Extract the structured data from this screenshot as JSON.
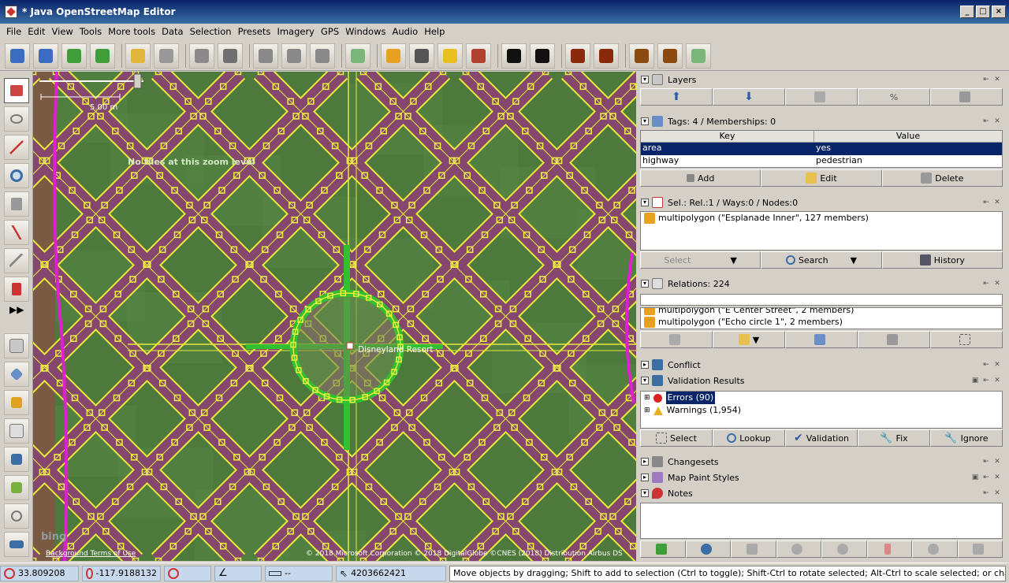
{
  "window": {
    "title": "* Java OpenStreetMap Editor"
  },
  "menu": [
    "File",
    "Edit",
    "View",
    "Tools",
    "More tools",
    "Data",
    "Selection",
    "Presets",
    "Imagery",
    "GPS",
    "Windows",
    "Audio",
    "Help"
  ],
  "toolbar": {
    "icons": [
      "open-icon",
      "save-icon",
      "download-icon",
      "upload-icon",
      "undo-icon",
      "redo-icon",
      "zoom-data-icon",
      "preferences-icon",
      "split-way-icon",
      "combine-way-icon",
      "reverse-way-icon",
      "orthogonalize-icon",
      "highway-preset-icon",
      "road-preset-icon",
      "traffic-signals-icon",
      "barrier-preset-icon",
      "car-icon",
      "bus-icon",
      "shop-icon",
      "restaurant-icon",
      "castle-icon",
      "industrial-icon",
      "waterway-icon"
    ],
    "colors": [
      "#3b6cc2",
      "#3b6cc2",
      "#3f9e3a",
      "#3f9e3a",
      "#e2b63a",
      "#999999",
      "#8a8a8a",
      "#707070",
      "#8a8a8a",
      "#8a8a8a",
      "#8a8a8a",
      "#7ab87a",
      "#e8a020",
      "#555555",
      "#e8c020",
      "#b04030",
      "#111111",
      "#111111",
      "#8a2a0a",
      "#8a2a0a",
      "#8a4a10",
      "#8a4a10",
      "#7ab87a"
    ]
  },
  "map": {
    "scale_label": "5.00 m",
    "no_tiles_label": "No tiles at this zoom level",
    "poi_label": "Disneyland Resort",
    "attribution": "© 2018 Microsoft Corporation © 2018 DigitalGlobe ©CNES (2018) Distribution Airbus DS",
    "bg_terms": "Background Terms of Use",
    "bing_logo": "bing"
  },
  "panels": {
    "layers": {
      "title": "Layers"
    },
    "tags": {
      "title": "Tags: 4 / Memberships: 0",
      "col_key": "Key",
      "col_value": "Value",
      "rows": [
        {
          "key": "area",
          "value": "yes"
        },
        {
          "key": "highway",
          "value": "pedestrian"
        }
      ],
      "add": "Add",
      "edit": "Edit",
      "delete": "Delete"
    },
    "selection": {
      "title": "Sel.: Rel.:1 / Ways:0 / Nodes:0",
      "item": "multipolygon (\"Esplanade Inner\", 127 members)",
      "select": "Select",
      "search": "Search",
      "history": "History"
    },
    "relations": {
      "title": "Relations: 224",
      "items": [
        "multipolygon (\"E Center Street\", 2 members)",
        "multipolygon (\"Echo circle 1\", 2 members)"
      ]
    },
    "conflict": {
      "title": "Conflict"
    },
    "validation": {
      "title": "Validation Results",
      "errors": "Errors (90)",
      "warnings": "Warnings (1,954)",
      "select": "Select",
      "lookup": "Lookup",
      "validation": "Validation",
      "fix": "Fix",
      "ignore": "Ignore"
    },
    "changesets": {
      "title": "Changesets"
    },
    "mappaint": {
      "title": "Map Paint Styles"
    },
    "notes": {
      "title": "Notes"
    }
  },
  "status": {
    "lat": "33.809208",
    "lon": "-117.9188132",
    "heading": "",
    "angle": "",
    "length": "--",
    "id": "4203662421",
    "message": "Move objects by dragging; Shift to add to selection (Ctrl to toggle); Shift-Ctrl to rotate selected; Alt-Ctrl to scale selected; or change selection"
  }
}
